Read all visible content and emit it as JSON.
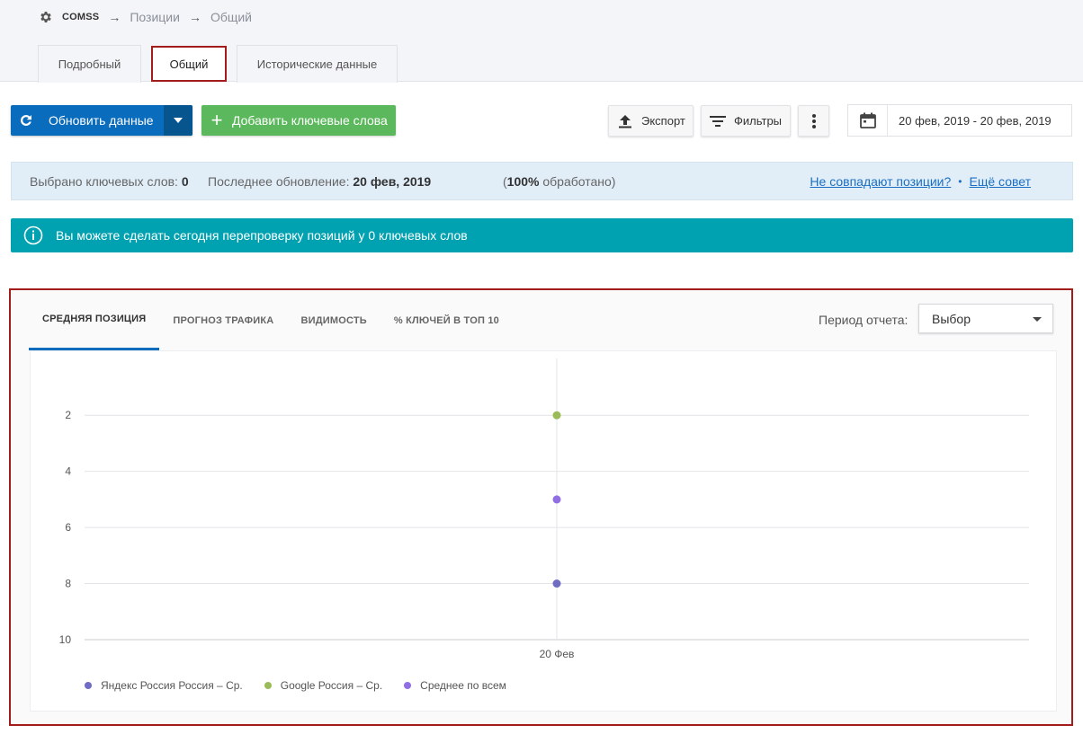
{
  "breadcrumb": {
    "project": "COMSS",
    "separator": "→",
    "items": [
      "Позиции",
      "Общий"
    ]
  },
  "tabs": [
    {
      "label": "Подробный",
      "active": false
    },
    {
      "label": "Общий",
      "active": true
    },
    {
      "label": "Исторические данные",
      "active": false
    }
  ],
  "toolbar": {
    "update_label": "Обновить данные",
    "add_keywords_label": "Добавить ключевые слова",
    "export_label": "Экспорт",
    "filters_label": "Фильтры",
    "date_range": "20 фев, 2019 - 20 фев, 2019"
  },
  "info": {
    "selected_label": "Выбрано ключевых слов:",
    "selected_count": "0",
    "last_update_label": "Последнее обновление:",
    "last_update_value": "20 фев, 2019",
    "processed_open": "(",
    "processed_value": "100%",
    "processed_text": " обработано)",
    "mismatch_link": "Не совпадают позиции?",
    "tip_link": "Ещё совет"
  },
  "notice": {
    "text": "Вы можете сделать сегодня перепроверку позиций у 0 ключевых слов"
  },
  "chart_tabs": [
    {
      "label": "СРЕДНЯЯ ПОЗИЦИЯ",
      "active": true
    },
    {
      "label": "ПРОГНОЗ ТРАФИКА",
      "active": false
    },
    {
      "label": "ВИДИМОСТЬ",
      "active": false
    },
    {
      "label": "% КЛЮЧЕЙ В ТОП 10",
      "active": false
    }
  ],
  "period": {
    "label": "Период отчета:",
    "selected": "Выбор"
  },
  "colors": {
    "primary": "#0a6cbd",
    "success": "#5cb85c",
    "notice": "#00a2b1",
    "highlight_border": "#a31c1c"
  },
  "chart_data": {
    "type": "scatter",
    "categories": [
      "20 Фев"
    ],
    "y_ticks": [
      2,
      4,
      6,
      8,
      10
    ],
    "ylim": [
      1,
      10
    ],
    "y_inverted": true,
    "grid": true,
    "legend_position": "bottom-left",
    "series": [
      {
        "name": "Яндекс Россия Россия – Ср.",
        "color": "#6f6cc4",
        "values": [
          8
        ]
      },
      {
        "name": "Google Россия – Ср.",
        "color": "#9bbb59",
        "values": [
          2
        ]
      },
      {
        "name": "Среднее по всем",
        "color": "#8f6ee6",
        "values": [
          5
        ]
      }
    ]
  }
}
